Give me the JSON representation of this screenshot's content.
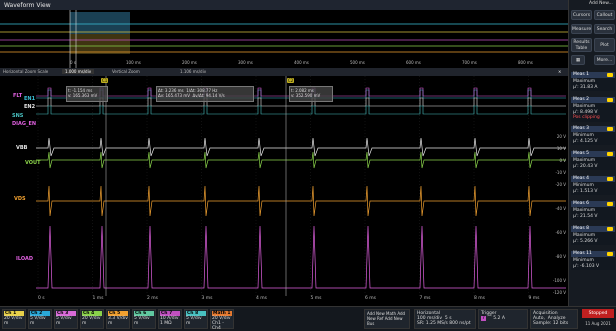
{
  "window": {
    "title": "Waveform View"
  },
  "overview_axis": [
    "0 s",
    "100 ms",
    "200 ms",
    "300 ms",
    "400 ms",
    "500 ms",
    "600 ms",
    "700 ms",
    "800 ms"
  ],
  "zoom_bar": {
    "label": "Horizontal Zoom Scale",
    "value": "1.000 ms/div",
    "vert_label": "Vertical Zoom",
    "vert_value": "1.106 ms/div"
  },
  "cursors": {
    "c1": {
      "label": "C1",
      "t": "t: -1.154 ms",
      "v": "v: 165.363 mV"
    },
    "delta": {
      "label": "",
      "dt": "Δt: 3.236 ms",
      "inv": "1/Δt: 308.77 Hz",
      "dv": "Δv: 165.473 mV",
      "dvdt": "Δv/Δt: 94.14 V/s"
    },
    "c2": {
      "label": "C2",
      "t": "t: 2.082 ms",
      "v": "v: 352.590 mV"
    }
  },
  "channels_left": [
    "FLT",
    "EN1",
    "EN2",
    "SNS",
    "DIAG_EN",
    "VBB",
    "VOUT",
    "VDS",
    "ILOAD"
  ],
  "time_axis": [
    "0 s",
    "1 ms",
    "2 ms",
    "3 ms",
    "4 ms",
    "5 ms",
    "6 ms",
    "7 ms",
    "8 ms",
    "9 ms"
  ],
  "right_scale": [
    "20 V",
    "10 V",
    "0 V",
    "-10 V",
    "-20 V",
    "-40 V",
    "-60 V",
    "-80 V",
    "-100 V",
    "-120 V"
  ],
  "sidebar": {
    "add_new": "Add New...",
    "buttons": [
      "Cursors",
      "Callout",
      "Measure",
      "Search",
      "Results Table",
      "Plot",
      "More..."
    ]
  },
  "measurements": [
    {
      "name": "Meas 1",
      "type": "Maximum",
      "value": "μ': 31.83 A",
      "color": "#ffd400"
    },
    {
      "name": "Meas 2",
      "type": "Maximum",
      "value": "μ': 8.498 V",
      "note": "Pos clipping",
      "color": "#ffd400"
    },
    {
      "name": "Meas 3",
      "type": "Minimum",
      "value": "μ': 4.125 V",
      "color": "#ffd400"
    },
    {
      "name": "Meas 5",
      "type": "Maximum",
      "value": "μ': 20.43 V",
      "color": "#ffd400"
    },
    {
      "name": "Meas 4",
      "type": "Minimum",
      "value": "μ': 1.513 V",
      "color": "#ffd400"
    },
    {
      "name": "Meas 6",
      "type": "Maximum",
      "value": "μ': 21.54 V",
      "color": "#ffd400"
    },
    {
      "name": "Meas 8",
      "type": "Maximum",
      "value": "μ': 5.266 V",
      "color": "#ffd400"
    },
    {
      "name": "Meas 11",
      "type": "Minimum",
      "value": "μ': -6.103 V",
      "color": "#ffd400"
    }
  ],
  "bottom_channels": [
    {
      "name": "Ch 1",
      "scale": "20 V/div",
      "sub": "m",
      "color": "#e8d14a"
    },
    {
      "name": "Ch 2",
      "scale": "5 V/div",
      "sub": "m",
      "color": "#2aa8d8"
    },
    {
      "name": "Ch 3",
      "scale": "5 V/div",
      "sub": "m",
      "color": "#d86ad8"
    },
    {
      "name": "Ch 4",
      "scale": "20 V/div",
      "sub": "m",
      "color": "#8ad24a"
    },
    {
      "name": "Ch 5",
      "scale": "3.3 V/div",
      "sub": "m",
      "color": "#f0a030"
    },
    {
      "name": "Ch 6",
      "scale": "5 V/div",
      "sub": "m",
      "color": "#60c8a0"
    },
    {
      "name": "Ch 7",
      "scale": "10 A/div",
      "sub": "1 MΩ",
      "color": "#c050c0"
    },
    {
      "name": "Ch 8",
      "scale": "5 V/div",
      "sub": "m",
      "color": "#48c0c0"
    },
    {
      "name": "Math 1",
      "scale": "20 V/div",
      "sub": "Ch1 - Ch4",
      "color": "#e67a30"
    }
  ],
  "add_buttons": [
    "Add New Math",
    "Add New Ref",
    "Add New Bus"
  ],
  "horizontal": {
    "label": "Horizontal",
    "scale": "100 ms/div",
    "total": "5 s",
    "sr": "SR: 1.25 MS/s",
    "rl": "800 ns/pt"
  },
  "trigger": {
    "label": "Trigger",
    "value": "5.2 A"
  },
  "acquisition": {
    "label": "Acquisition",
    "mode": "Auto,",
    "analyze": "Analyze",
    "samples": "Sample: 12 bits"
  },
  "status": {
    "state": "Stopped",
    "date": "11 Aug 2021"
  }
}
